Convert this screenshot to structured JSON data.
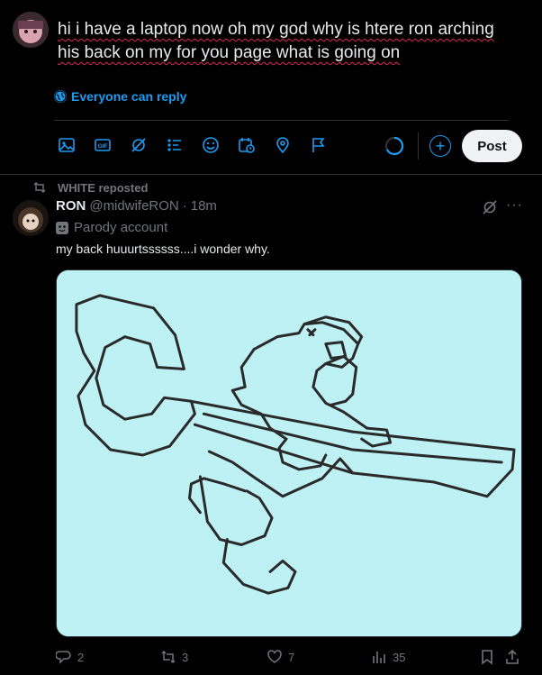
{
  "compose": {
    "text": "hi i have  a laptop now oh my god why is htere ron arching his back on my for you page what is going on",
    "reply_setting": "Everyone can reply",
    "post_label": "Post",
    "add_label": "+",
    "toolbar_icons": [
      "image-icon",
      "gif-icon",
      "grok-icon",
      "poll-icon",
      "emoji-icon",
      "schedule-icon",
      "location-icon",
      "flag-icon"
    ],
    "gif_text": "GIF"
  },
  "tweet": {
    "repost_text": "WHITE reposted",
    "name": "RON",
    "handle": "@midwifeRON",
    "dot": "·",
    "time": "18m",
    "badge": "Parody account",
    "text": "my back huuurtssssss....i wonder why.",
    "replies": "2",
    "reposts": "3",
    "likes": "7",
    "views": "35",
    "more": "···"
  },
  "colors": {
    "accent": "#1d9bf0",
    "muted": "#71767b",
    "media_bg": "#bdf1f3",
    "spellcheck": "#e0245e"
  }
}
